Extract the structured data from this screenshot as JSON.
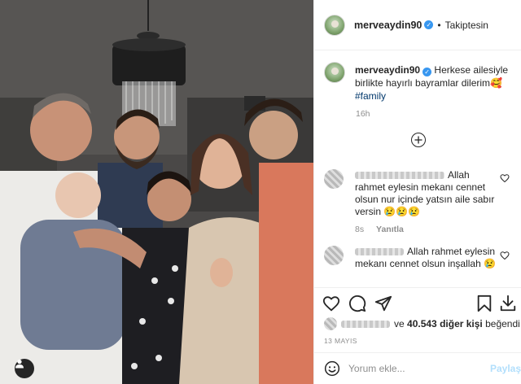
{
  "header": {
    "username": "merveaydin90",
    "separator": "•",
    "follow_label": "Takiptesin"
  },
  "caption": {
    "username": "merveaydin90",
    "text": "Herkese ailesiyle birlikte hayırlı bayramlar dilerim🥰",
    "hashtag": "#family",
    "time": "16h"
  },
  "comments": [
    {
      "text": "Allah rahmet eylesin mekanı cennet olsun nur içinde yatsın aile sabır versin 😢😢😢",
      "time": "8s",
      "reply_label": "Yanıtla"
    },
    {
      "text": "Allah rahmet eylesin mekanı cennet olsun inşallah 😢"
    }
  ],
  "likes": {
    "conjunction": "ve",
    "count_text": "40.543 diğer kişi",
    "suffix": "beğendi"
  },
  "date": "13 MAYIS",
  "comment_box": {
    "placeholder": "Yorum ekle...",
    "submit_label": "Paylaş"
  },
  "icons": {
    "photo_user_tag": "user-icon",
    "load_more": "plus-circle-icon",
    "like": "heart-icon",
    "comment": "comment-icon",
    "share": "paper-plane-icon",
    "save": "bookmark-icon",
    "download": "download-icon",
    "emoji": "smiley-icon"
  },
  "colors": {
    "link": "#00376b",
    "verified": "#3897f0",
    "muted": "#8e8e8e",
    "submit_disabled": "#b2dffc"
  }
}
